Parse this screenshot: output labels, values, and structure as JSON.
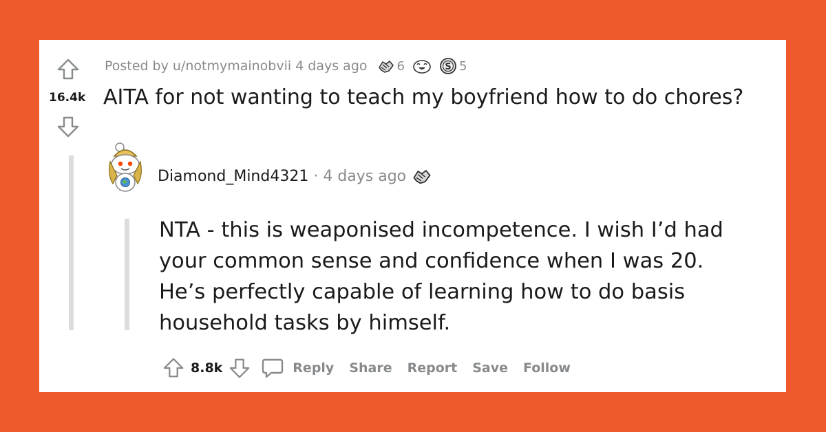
{
  "post": {
    "posted_by": "Posted by u/notmymainobvii",
    "time_ago": "4 days ago",
    "awards": [
      {
        "icon": "handshake-award-icon",
        "count": "6"
      },
      {
        "icon": "laughing-face-award-icon",
        "count": ""
      },
      {
        "icon": "silver-coin-award-icon",
        "count": "5"
      }
    ],
    "score": "16.4k",
    "title": "AITA for not wanting to teach my boyfriend how to do chores?"
  },
  "comment": {
    "username": "Diamond_Mind4321",
    "separator": "·",
    "time_ago": "4 days ago",
    "award_icon": "handshake-award-icon",
    "body_lines": [
      "NTA - this is weaponised incompetence. I wish I’d had",
      "your common sense and confidence when I was 20.",
      "He’s perfectly capable of learning how to do basis",
      "household tasks by himself."
    ],
    "score": "8.8k",
    "actions": {
      "reply": "Reply",
      "share": "Share",
      "report": "Report",
      "save": "Save",
      "follow": "Follow"
    }
  },
  "colors": {
    "background": "#EE5A2B",
    "card": "#FFFFFF",
    "text": "#1A1A1B",
    "muted": "#878A8C"
  }
}
